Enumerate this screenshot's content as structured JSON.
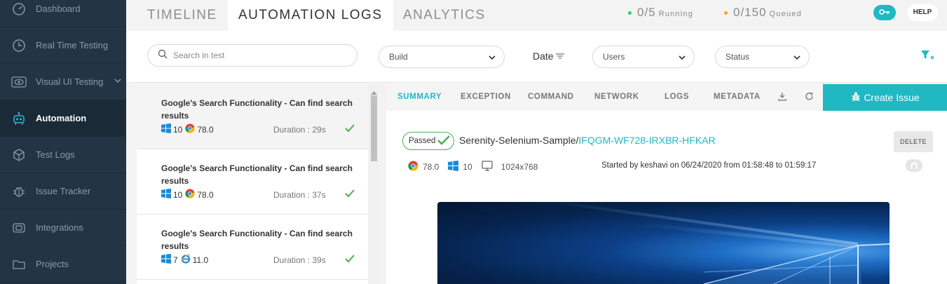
{
  "sidebar": {
    "items": [
      {
        "label": "Dashboard",
        "icon": "gauge-icon"
      },
      {
        "label": "Real Time Testing",
        "icon": "clock-icon"
      },
      {
        "label": "Visual UI Testing",
        "icon": "eye-icon"
      },
      {
        "label": "Automation",
        "icon": "robot-icon"
      },
      {
        "label": "Test Logs",
        "icon": "cube-icon"
      },
      {
        "label": "Issue Tracker",
        "icon": "bug-icon"
      },
      {
        "label": "Integrations",
        "icon": "integrations-icon"
      },
      {
        "label": "Projects",
        "icon": "folder-icon"
      }
    ],
    "active": "Automation"
  },
  "tabs": [
    "TIMELINE",
    "AUTOMATION LOGS",
    "ANALYTICS"
  ],
  "active_tab": "AUTOMATION LOGS",
  "status": {
    "running_value": "0/5",
    "running_label": "Running",
    "queued_value": "0/150",
    "queued_label": "Queued"
  },
  "help_label": "HELP",
  "filters": {
    "search_placeholder": "Search in test",
    "build": "Build",
    "date": "Date",
    "users": "Users",
    "status": "Status"
  },
  "tests": [
    {
      "title": "Google's Search Functionality - Can find search results",
      "os_version": "10",
      "browser": "chrome",
      "browser_version": "78.0",
      "duration": "Duration : 29s"
    },
    {
      "title": "Google's Search Functionality - Can find search results",
      "os_version": "10",
      "browser": "chrome",
      "browser_version": "78.0",
      "duration": "Duration : 37s"
    },
    {
      "title": "Google's Search Functionality - Can find search results",
      "os_version": "7",
      "browser": "ie",
      "browser_version": "11.0",
      "duration": "Duration : 39s"
    }
  ],
  "detail": {
    "tabs": [
      "SUMMARY",
      "EXCEPTION",
      "COMMAND",
      "NETWORK",
      "LOGS",
      "METADATA"
    ],
    "active_tab": "SUMMARY",
    "create_issue_label": "Create Issue",
    "status_label": "Passed",
    "project_name": "Serenity-Selenium-Sample/",
    "test_id": "IFQGM-WF728-IRXBR-HFKAR",
    "delete_label": "DELETE",
    "browser_version": "78.0",
    "os_version": "10",
    "resolution": "1024x768",
    "started": "Started by keshavi on 06/24/2020 from 01:58:48 to 01:59:17"
  },
  "colors": {
    "accent": "#1fb8c3",
    "running_dot": "#2ecc71",
    "queued_dot": "#f5a623",
    "success": "#4caf50",
    "sidebar_bg": "#233545"
  }
}
